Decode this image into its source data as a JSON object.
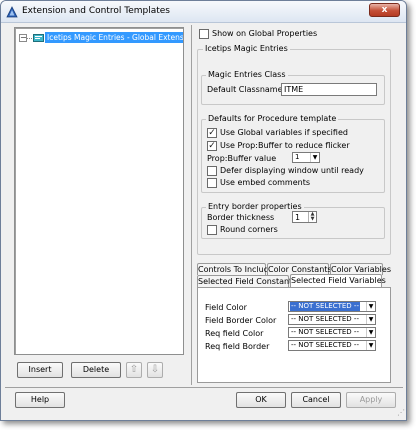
{
  "window": {
    "title": "Extension and Control Templates",
    "close_glyph": "x"
  },
  "tree": {
    "item_label": "Icetips Magic Entries - Global Extension",
    "expander_glyph": "−"
  },
  "left_buttons": {
    "insert": "Insert",
    "delete": "Delete",
    "up_glyph": "⇧",
    "down_glyph": "⇩"
  },
  "right": {
    "show_global": {
      "label": "Show on Global Properties",
      "checked": false
    },
    "main_group_title": "Icetips Magic Entries",
    "class_group": {
      "title": "Magic Entries Class",
      "default_classname_label": "Default Classname",
      "default_classname_value": "ITME"
    },
    "defaults_group": {
      "title": "Defaults for Procedure template",
      "use_global": {
        "label": "Use Global variables if specified",
        "checked": true
      },
      "use_prop_buffer": {
        "label": "Use Prop:Buffer to reduce flicker",
        "checked": true
      },
      "prop_buffer_label": "Prop:Buffer value",
      "prop_buffer_value": "1",
      "defer_display": {
        "label": "Defer displaying window until ready",
        "checked": false
      },
      "embed_comments": {
        "label": "Use embed comments",
        "checked": false
      }
    },
    "border_group": {
      "title": "Entry border properties",
      "thickness_label": "Border thickness",
      "thickness_value": "1",
      "round_corners": {
        "label": "Round corners",
        "checked": false
      }
    },
    "tabs_row1": [
      "Controls To Include",
      "Color Constants",
      "Color Variables"
    ],
    "tabs_row2": [
      "Selected Field Constants",
      "Selected Field Variables"
    ],
    "active_tab": "Selected Field Variables",
    "fields": [
      {
        "label": "Field Color",
        "value": "-- NOT SELECTED --",
        "selected": true
      },
      {
        "label": "Field Border Color",
        "value": "-- NOT SELECTED --",
        "selected": false
      },
      {
        "label": "Req field Color",
        "value": "-- NOT SELECTED --",
        "selected": false
      },
      {
        "label": "Req field Border",
        "value": "-- NOT SELECTED --",
        "selected": false
      }
    ]
  },
  "bottom_buttons": {
    "help": "Help",
    "ok": "OK",
    "cancel": "Cancel",
    "apply": "Apply"
  },
  "colors": {
    "accent": "#3a6fd0",
    "selection_highlight": "#3399ff"
  }
}
